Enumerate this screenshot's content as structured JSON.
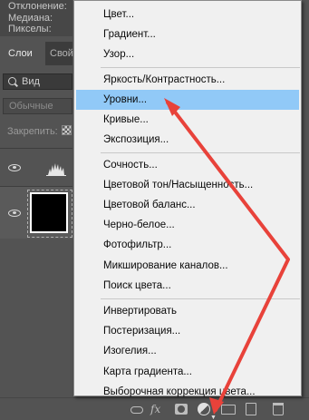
{
  "info_panel": {
    "deviation_label": "Отклонение:",
    "median_label": "Медиана:",
    "pixels_label": "Пикселы:"
  },
  "layers_panel": {
    "tabs": [
      {
        "label": "Слои"
      },
      {
        "label": "Свой"
      }
    ],
    "filter_kind": "Вид",
    "blend_mode": "Обычные",
    "lock_label": "Закрепить:"
  },
  "adjustment_menu": {
    "groups": [
      [
        {
          "label": "Цвет..."
        },
        {
          "label": "Градиент..."
        },
        {
          "label": "Узор..."
        }
      ],
      [
        {
          "label": "Яркость/Контрастность..."
        },
        {
          "label": "Уровни...",
          "selected": true
        },
        {
          "label": "Кривые..."
        },
        {
          "label": "Экспозиция..."
        }
      ],
      [
        {
          "label": "Сочность..."
        },
        {
          "label": "Цветовой тон/Насыщенность..."
        },
        {
          "label": "Цветовой баланс..."
        },
        {
          "label": "Черно-белое..."
        },
        {
          "label": "Фотофильтр..."
        },
        {
          "label": "Микширование каналов..."
        },
        {
          "label": "Поиск цвета..."
        }
      ],
      [
        {
          "label": "Инвертировать"
        },
        {
          "label": "Постеризация..."
        },
        {
          "label": "Изогелия..."
        },
        {
          "label": "Карта градиента..."
        },
        {
          "label": "Выборочная коррекция цвета..."
        }
      ]
    ]
  },
  "bottom_toolbar": {
    "icons": [
      "link-layers-icon",
      "fx-icon",
      "add-mask-icon",
      "adjustment-layer-icon",
      "new-group-icon",
      "new-layer-icon",
      "trash-icon"
    ],
    "fx_label": "fx"
  },
  "colors": {
    "annotation": "#e8423a",
    "menu_highlight": "#91c9f7",
    "panel_bg": "#535353",
    "menu_bg": "#f0f0f0"
  }
}
